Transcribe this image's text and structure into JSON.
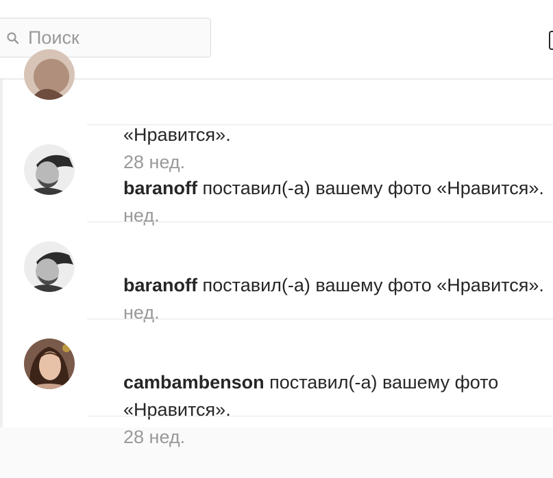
{
  "search": {
    "placeholder": "Поиск",
    "icon": "search-icon"
  },
  "notifications": [
    {
      "username": "",
      "action_cont": "«Нравится».",
      "time": "28 нед.",
      "avatar": "avatar-photo-partial"
    },
    {
      "username": "baranoff",
      "action": " поставил(-а) вашему фото «Нравится».",
      "time_cont": "нед.",
      "avatar": "avatar-photo-grayscale"
    },
    {
      "username": "baranoff",
      "action": " поставил(-а) вашему фото «Нравится».",
      "time_cont": "нед.",
      "avatar": "avatar-photo-grayscale"
    },
    {
      "username": "cambambenson",
      "action": " поставил(-а) вашему фото",
      "action_line2": "«Нравится».",
      "time": "28 нед.",
      "avatar": "avatar-photo-color"
    }
  ],
  "colors": {
    "text": "#262626",
    "muted": "#999999",
    "border": "#dbdbdb",
    "background": "#fafafa"
  }
}
